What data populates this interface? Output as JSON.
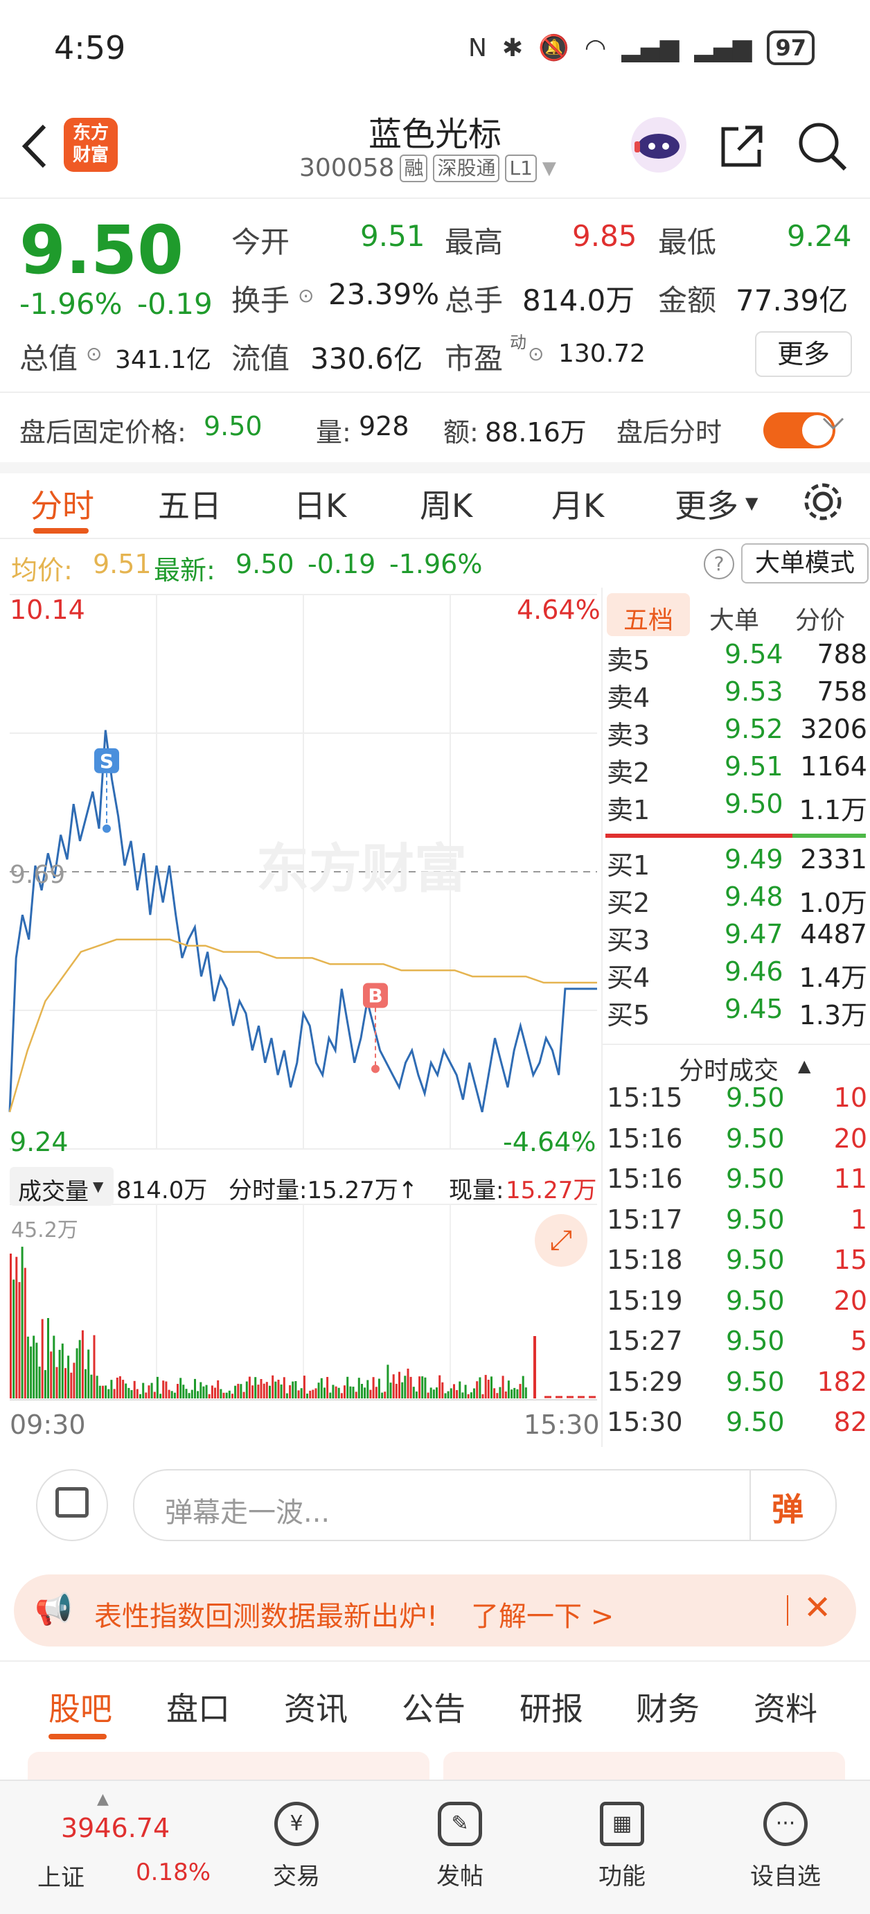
{
  "status_bar": {
    "time": "4:59",
    "battery": "97"
  },
  "header": {
    "logo_text": "东方\n财富",
    "stock_name": "蓝色光标",
    "stock_code": "300058",
    "tags": [
      "融",
      "深股通",
      "L1"
    ]
  },
  "quote": {
    "price": "9.50",
    "change_pct": "-1.96%",
    "change": "-0.19",
    "open_label": "今开",
    "open": "9.51",
    "high_label": "最高",
    "high": "9.85",
    "low_label": "最低",
    "low": "9.24",
    "turnover_label": "换手",
    "turnover": "23.39%",
    "volume_label": "总手",
    "volume": "814.0万",
    "amount_label": "金额",
    "amount": "77.39亿",
    "total_cap_label": "总值",
    "total_cap": "341.1亿",
    "float_cap_label": "流值",
    "float_cap": "330.6亿",
    "pe_label": "市盈",
    "pe_sup": "动",
    "pe": "130.72",
    "more_label": "更多"
  },
  "after_hours": {
    "price_label": "盘后固定价格:",
    "price": "9.50",
    "vol_label": "量:",
    "vol": "928",
    "amt_label": "额:",
    "amt": "88.16万",
    "toggle_label": "盘后分时"
  },
  "chart_tabs": [
    "分时",
    "五日",
    "日K",
    "周K",
    "月K",
    "更多"
  ],
  "info_line": {
    "avg_label": "均价:",
    "avg": "9.51",
    "latest_label": "最新:",
    "latest": "9.50",
    "chg": "-0.19",
    "chg_pct": "-1.96%",
    "mode_btn": "大单模式"
  },
  "chart_data": {
    "type": "line",
    "price_max": "10.14",
    "price_min": "9.24",
    "pct_max": "4.64%",
    "pct_min": "-4.64%",
    "ref_price": "9.69",
    "y_range": [
      9.24,
      10.14
    ],
    "x_start": "09:30",
    "x_end": "15:30",
    "watermark": "东方财富",
    "markers": [
      {
        "label": "S",
        "price": 9.76
      },
      {
        "label": "B",
        "price": 9.37
      }
    ],
    "series": [
      {
        "values": [
          9.3,
          9.55,
          9.62,
          9.58,
          9.7,
          9.66,
          9.72,
          9.68,
          9.75,
          9.71,
          9.8,
          9.74,
          9.78,
          9.82,
          9.76,
          9.92,
          9.84,
          9.78,
          9.7,
          9.74,
          9.66,
          9.72,
          9.62,
          9.7,
          9.64,
          9.7,
          9.62,
          9.55,
          9.58,
          9.6,
          9.52,
          9.56,
          9.48,
          9.52,
          9.5,
          9.44,
          9.48,
          9.46,
          9.4,
          9.44,
          9.38,
          9.42,
          9.36,
          9.4,
          9.34,
          9.38,
          9.46,
          9.44,
          9.38,
          9.36,
          9.42,
          9.4,
          9.5,
          9.44,
          9.38,
          9.42,
          9.48,
          9.44,
          9.4,
          9.38,
          9.36,
          9.34,
          9.38,
          9.4,
          9.36,
          9.33,
          9.38,
          9.36,
          9.4,
          9.38,
          9.36,
          9.32,
          9.38,
          9.34,
          9.3,
          9.36,
          9.42,
          9.38,
          9.34,
          9.4,
          9.44,
          9.4,
          9.36,
          9.38,
          9.42,
          9.4,
          9.36,
          9.5,
          9.5,
          9.5,
          9.5,
          9.5,
          9.5
        ]
      },
      {
        "values": [
          9.3,
          9.4,
          9.48,
          9.52,
          9.56,
          9.57,
          9.58,
          9.58,
          9.58,
          9.58,
          9.57,
          9.57,
          9.56,
          9.56,
          9.56,
          9.55,
          9.55,
          9.55,
          9.54,
          9.54,
          9.54,
          9.54,
          9.53,
          9.53,
          9.53,
          9.53,
          9.52,
          9.52,
          9.52,
          9.52,
          9.51,
          9.51,
          9.51,
          9.51
        ]
      }
    ]
  },
  "volume_panel": {
    "label": "成交量",
    "total": "814.0万",
    "minute_label": "分时量:15.27万↑",
    "now_label": "现量:",
    "now": "15.27万",
    "max": "45.2万"
  },
  "orderbook": {
    "tabs": [
      "五档",
      "大单",
      "分价"
    ],
    "asks": [
      {
        "label": "卖5",
        "price": "9.54",
        "vol": "788"
      },
      {
        "label": "卖4",
        "price": "9.53",
        "vol": "758"
      },
      {
        "label": "卖3",
        "price": "9.52",
        "vol": "3206"
      },
      {
        "label": "卖2",
        "price": "9.51",
        "vol": "1164"
      },
      {
        "label": "卖1",
        "price": "9.50",
        "vol": "1.1万"
      }
    ],
    "bids": [
      {
        "label": "买1",
        "price": "9.49",
        "vol": "2331"
      },
      {
        "label": "买2",
        "price": "9.48",
        "vol": "1.0万"
      },
      {
        "label": "买3",
        "price": "9.47",
        "vol": "4487"
      },
      {
        "label": "买4",
        "price": "9.46",
        "vol": "1.4万"
      },
      {
        "label": "买5",
        "price": "9.45",
        "vol": "1.3万"
      }
    ],
    "trades_title": "分时成交",
    "trades": [
      {
        "time": "15:15",
        "price": "9.50",
        "vol": "10"
      },
      {
        "time": "15:16",
        "price": "9.50",
        "vol": "20"
      },
      {
        "time": "15:16",
        "price": "9.50",
        "vol": "11"
      },
      {
        "time": "15:17",
        "price": "9.50",
        "vol": "1"
      },
      {
        "time": "15:18",
        "price": "9.50",
        "vol": "15"
      },
      {
        "time": "15:19",
        "price": "9.50",
        "vol": "20"
      },
      {
        "time": "15:27",
        "price": "9.50",
        "vol": "5"
      },
      {
        "time": "15:29",
        "price": "9.50",
        "vol": "182"
      },
      {
        "time": "15:30",
        "price": "9.50",
        "vol": "82"
      }
    ]
  },
  "danmu": {
    "placeholder": "弹幕走一波...",
    "btn": "弹"
  },
  "banner": {
    "text": "表性指数回测数据最新出炉!",
    "link": "了解一下 >"
  },
  "bottom_tabs": [
    "股吧",
    "盘口",
    "资讯",
    "公告",
    "研报",
    "财务",
    "资料"
  ],
  "tabbar": {
    "index_value": "3946.74",
    "index_name": "上证",
    "index_pct": "0.18%",
    "items": [
      "交易",
      "发帖",
      "功能",
      "设自选"
    ]
  },
  "colors": {
    "up": "#e0302f",
    "down": "#1f9b2c",
    "accent": "#e9591c",
    "avg_line": "#e5b450",
    "price_line": "#2f6cb4"
  }
}
